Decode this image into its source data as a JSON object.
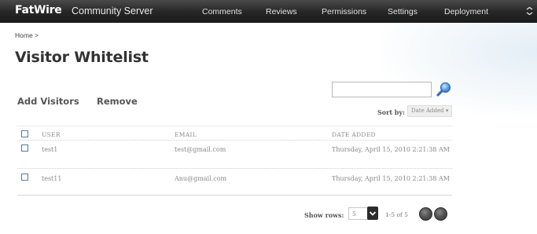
{
  "brand": {
    "name": "FatWire",
    "product": "Community Server"
  },
  "nav": {
    "items": [
      {
        "label": "Comments"
      },
      {
        "label": "Reviews"
      },
      {
        "label": "Permissions"
      },
      {
        "label": "Settings"
      },
      {
        "label": "Deployment"
      }
    ]
  },
  "breadcrumb": {
    "text": "Home >"
  },
  "page": {
    "title": "Visitor Whitelist"
  },
  "actions": {
    "add": "Add Visitors",
    "remove": "Remove"
  },
  "search": {
    "value": "",
    "placeholder": ""
  },
  "sort": {
    "label": "Sort by:",
    "selected": "Date Added ▾"
  },
  "table": {
    "columns": [
      "USER",
      "EMAIL",
      "DATE ADDED"
    ],
    "rows": [
      {
        "user": "test1",
        "email": "test@gmail.com",
        "date": "Thursday, April 15, 2010 2:21:38 AM"
      },
      {
        "user": "test11",
        "email": "Anu@gmail.com",
        "date": "Thursday, April 15, 2010 2:21:38 AM"
      }
    ]
  },
  "pagination": {
    "show_rows_label": "Show rows:",
    "rows_value": "5",
    "range": "1-5 of 5"
  },
  "colors": {
    "topbar": "#262626",
    "checkbox": "#4b79b8",
    "search_icon": "#3d7ec8"
  }
}
